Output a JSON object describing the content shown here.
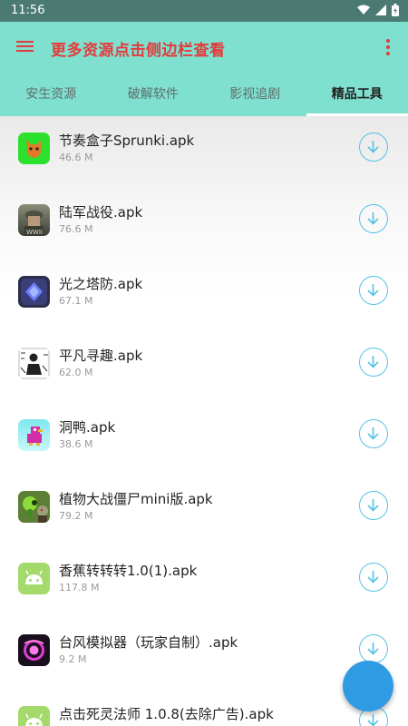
{
  "status_bar": {
    "time": "11:56"
  },
  "toolbar": {
    "title": "更多资源点击侧边栏查看"
  },
  "tabs": [
    {
      "label": "安生资源"
    },
    {
      "label": "破解软件"
    },
    {
      "label": "影视追剧"
    },
    {
      "label": "精品工具",
      "active": true
    }
  ],
  "files": [
    {
      "name": "节奏盒子Sprunki.apk",
      "size": "46.6 M",
      "icon": "sprunki-app-icon"
    },
    {
      "name": "陆军战役.apk",
      "size": "76.6 M",
      "icon": "soldier-game-icon"
    },
    {
      "name": "光之塔防.apk",
      "size": "67.1 M",
      "icon": "tower-defense-icon"
    },
    {
      "name": "平凡寻趣.apk",
      "size": "62.0 M",
      "icon": "comic-person-icon"
    },
    {
      "name": "洞鸭.apk",
      "size": "38.6 M",
      "icon": "pixel-duck-icon"
    },
    {
      "name": "植物大战僵尸mini版.apk",
      "size": "79.2 M",
      "icon": "plant-zombie-icon"
    },
    {
      "name": "香蕉转转转1.0(1).apk",
      "size": "117.8 M",
      "icon": "android-icon"
    },
    {
      "name": "台风模拟器（玩家自制）.apk",
      "size": "9.2 M",
      "icon": "typhoon-icon"
    },
    {
      "name": "点击死灵法师 1.0.8(去除广告).apk",
      "size": "",
      "icon": "android-icon"
    }
  ],
  "colors": {
    "app_bar": "#7fe0cf",
    "status_bar": "#4a7a72",
    "title_red": "#e33b3b",
    "download_blue": "#55c2e6",
    "fab_blue": "#2f9be3"
  }
}
